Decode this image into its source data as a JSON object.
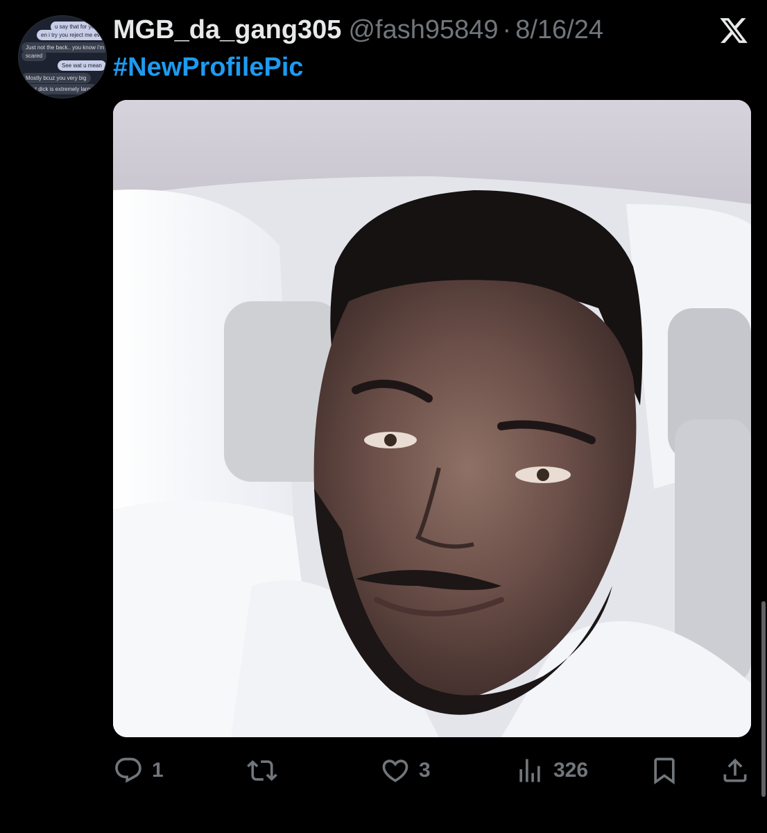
{
  "tweet": {
    "display_name": "MGB_da_gang305",
    "handle": "@fash95849",
    "separator": "·",
    "date": "8/16/24",
    "hashtag": "#NewProfilePic",
    "logo_icon": "x-logo-icon",
    "media_description_icon": "photo"
  },
  "avatar": {
    "messages": [
      "u say that for yo",
      "en i try you reject me everyo",
      "Just not the back.. you know i'm",
      "scared",
      "See wat u mean",
      "Mostly bcuz you very big",
      "That dick is extremely large"
    ]
  },
  "actions": {
    "reply_count": "1",
    "retweet_count": "",
    "like_count": "3",
    "views_count": "326",
    "icons": [
      "reply-icon",
      "retweet-icon",
      "like-icon",
      "views-icon",
      "bookmark-icon",
      "share-icon"
    ]
  },
  "colors": {
    "background": "#000000",
    "text_primary": "#e7e9ea",
    "text_secondary": "#71767b",
    "accent": "#1d9bf0"
  }
}
